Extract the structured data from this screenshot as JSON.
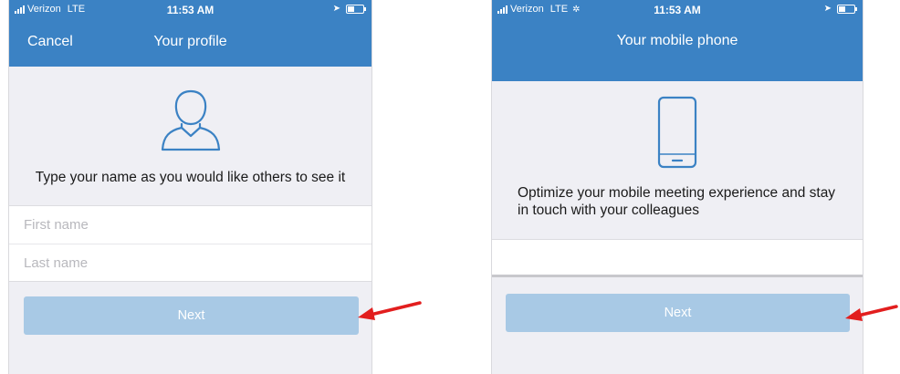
{
  "colors": {
    "header": "#3b82c4",
    "background": "#efeff4",
    "button_disabled": "#a8c9e5",
    "arrow": "#e21e1e"
  },
  "screen_profile": {
    "status": {
      "carrier": "Verizon",
      "network": "LTE",
      "time": "11:53 AM"
    },
    "nav": {
      "cancel_label": "Cancel",
      "title": "Your profile"
    },
    "icon": "user-outline-icon",
    "prompt": "Type your name as you would like others to see it",
    "first_name": {
      "placeholder": "First name",
      "value": ""
    },
    "last_name": {
      "placeholder": "Last name",
      "value": ""
    },
    "next_label": "Next"
  },
  "screen_phone": {
    "status": {
      "carrier": "Verizon",
      "network": "LTE",
      "time": "11:53 AM"
    },
    "nav": {
      "title": "Your mobile phone"
    },
    "icon": "mobile-phone-outline-icon",
    "prompt": "Optimize your mobile meeting experience and stay in touch with your colleagues",
    "phone_field": {
      "value": ""
    },
    "next_label": "Next"
  },
  "annotations": [
    "red-arrow-icon",
    "red-arrow-icon"
  ]
}
